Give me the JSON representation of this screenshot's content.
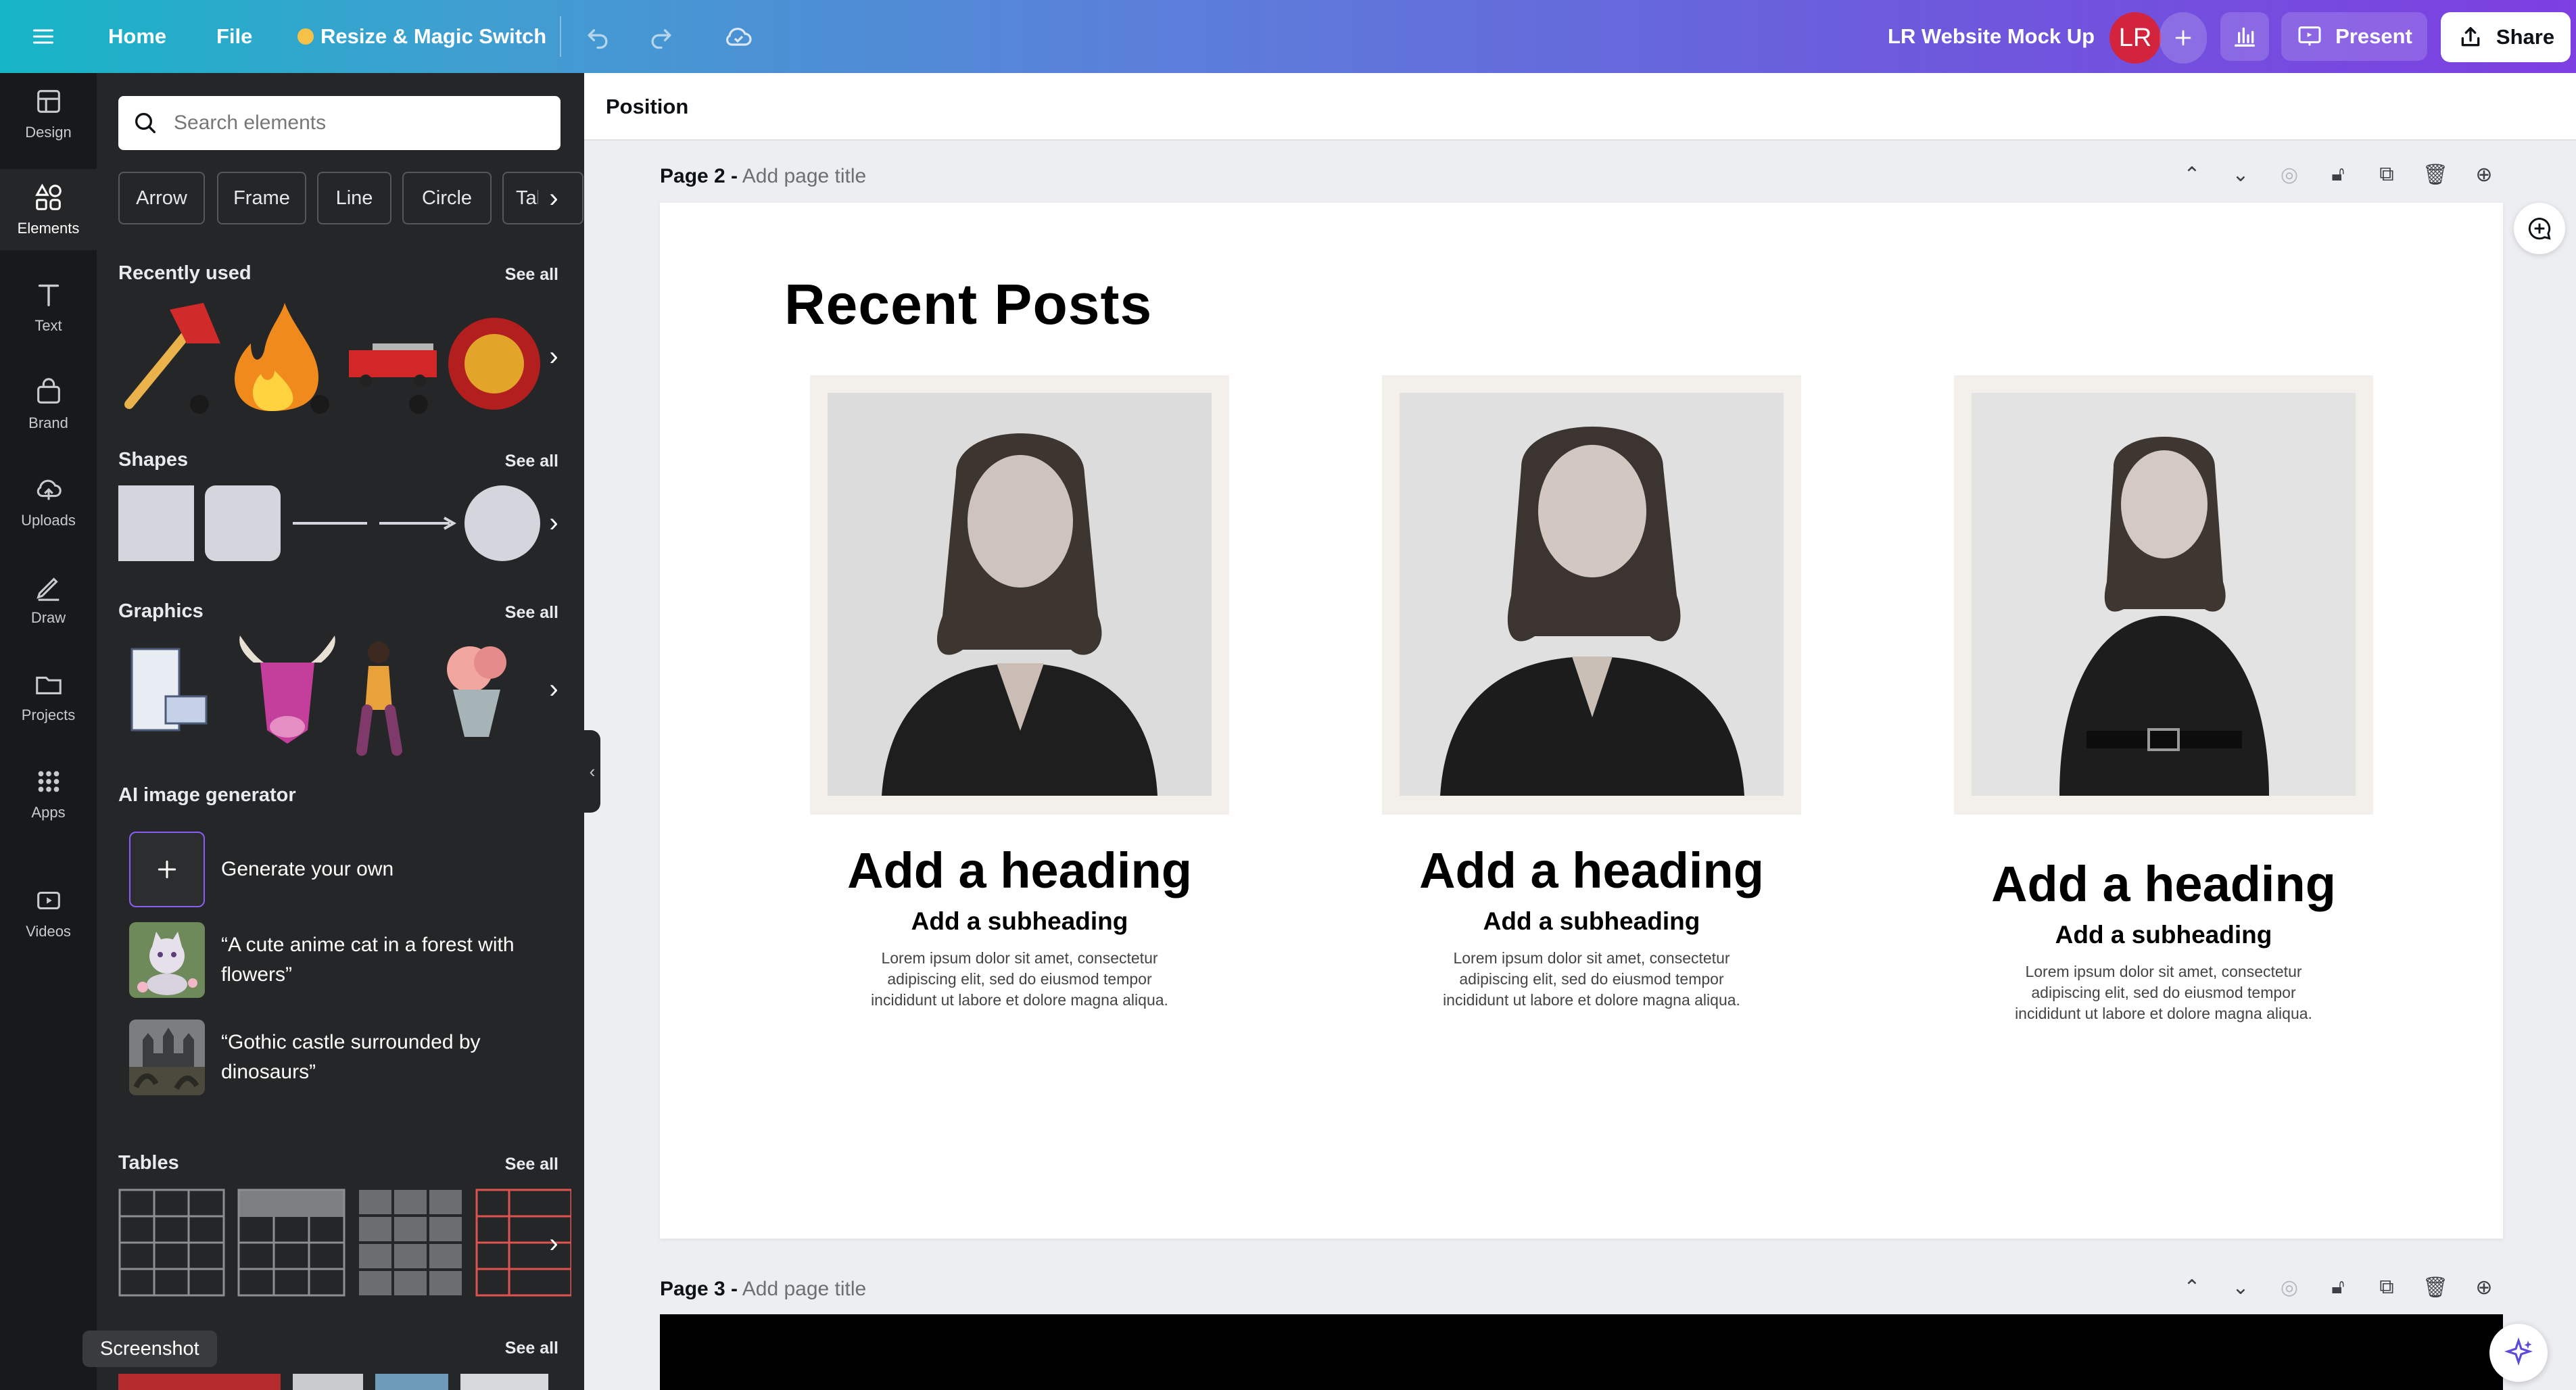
{
  "topbar": {
    "home": "Home",
    "file": "File",
    "resize": "Resize & Magic Switch",
    "doc_title": "LR Website Mock Up",
    "avatar": "LR",
    "present": "Present",
    "share": "Share"
  },
  "rail": {
    "design": "Design",
    "elements": "Elements",
    "text": "Text",
    "brand": "Brand",
    "uploads": "Uploads",
    "draw": "Draw",
    "projects": "Projects",
    "apps": "Apps",
    "videos": "Videos"
  },
  "panel": {
    "search_placeholder": "Search elements",
    "chips": [
      "Arrow",
      "Frame",
      "Line",
      "Circle",
      "Table"
    ],
    "recently_used": "Recently used",
    "shapes": "Shapes",
    "graphics": "Graphics",
    "ai_generator": "AI image generator",
    "generate_own": "Generate your own",
    "prompt1": "“A cute anime cat in a forest with flowers”",
    "prompt2": "“Gothic castle surrounded by dinosaurs”",
    "tables": "Tables",
    "see_all": "See all",
    "tooltip": "Screenshot"
  },
  "canvas": {
    "position": "Position",
    "page2_num": "Page 2 -",
    "page3_num": "Page 3 -",
    "page_title_placeholder": "Add page title",
    "title": "Recent Posts",
    "posts": [
      {
        "heading": "Add a heading",
        "subheading": "Add a subheading",
        "body": "Lorem ipsum dolor sit amet, consectetur adipiscing elit, sed do eiusmod tempor incididunt ut labore et dolore magna aliqua."
      },
      {
        "heading": "Add a heading",
        "subheading": "Add a subheading",
        "body": "Lorem ipsum dolor sit amet, consectetur adipiscing elit, sed do eiusmod tempor incididunt ut labore et dolore magna aliqua."
      },
      {
        "heading": "Add a heading",
        "subheading": "Add a subheading",
        "body": "Lorem ipsum dolor sit amet, consectetur adipiscing elit, sed do eiusmod tempor incididunt ut labore et dolore magna aliqua."
      }
    ]
  }
}
